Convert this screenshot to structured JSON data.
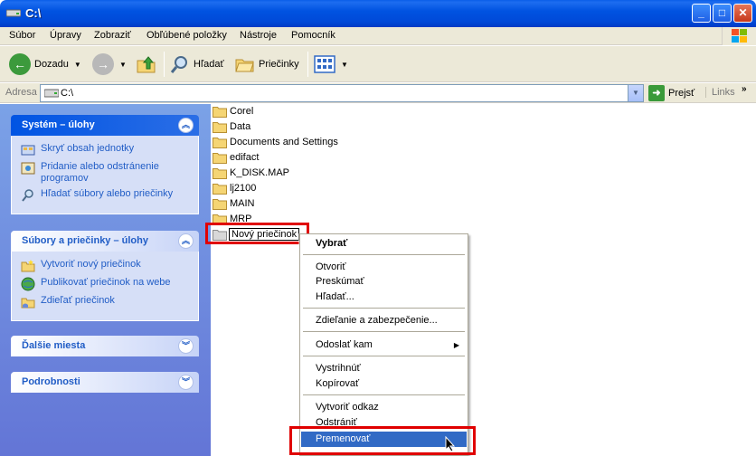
{
  "window": {
    "title": "C:\\"
  },
  "menu": [
    "Súbor",
    "Úpravy",
    "Zobraziť",
    "Obľúbené položky",
    "Nástroje",
    "Pomocník"
  ],
  "toolbar": {
    "back": "Dozadu",
    "search": "Hľadať",
    "folders": "Priečinky"
  },
  "address": {
    "label": "Adresa",
    "value": "C:\\",
    "go": "Prejsť",
    "links": "Links"
  },
  "left": {
    "system": {
      "title": "Systém – úlohy",
      "items": [
        "Skryť obsah jednotky",
        "Pridanie alebo odstránenie programov",
        "Hľadať súbory alebo priečinky"
      ]
    },
    "files": {
      "title": "Súbory a priečinky – úlohy",
      "items": [
        "Vytvoriť nový priečinok",
        "Publikovať priečinok na webe",
        "Zdieľať priečinok"
      ]
    },
    "other": {
      "title": "Ďalšie miesta"
    },
    "details": {
      "title": "Podrobnosti"
    }
  },
  "files": [
    "Corel",
    "Data",
    "Documents and Settings",
    "edifact",
    "K_DISK.MAP",
    "lj2100",
    "MAIN",
    "MRP"
  ],
  "rename_value": "Nový priečinok",
  "context_menu": [
    "Vybrať",
    "Otvoriť",
    "Preskúmať",
    "Hľadať...",
    "Zdieľanie a zabezpečenie...",
    "Odoslať kam",
    "Vystrihnúť",
    "Kopírovať",
    "Vytvoriť odkaz",
    "Odstrániť",
    "Premenovať"
  ],
  "colors": {
    "highlight_box": "#e00000",
    "selection": "#316ac5",
    "title_bar": "#0053e1"
  }
}
